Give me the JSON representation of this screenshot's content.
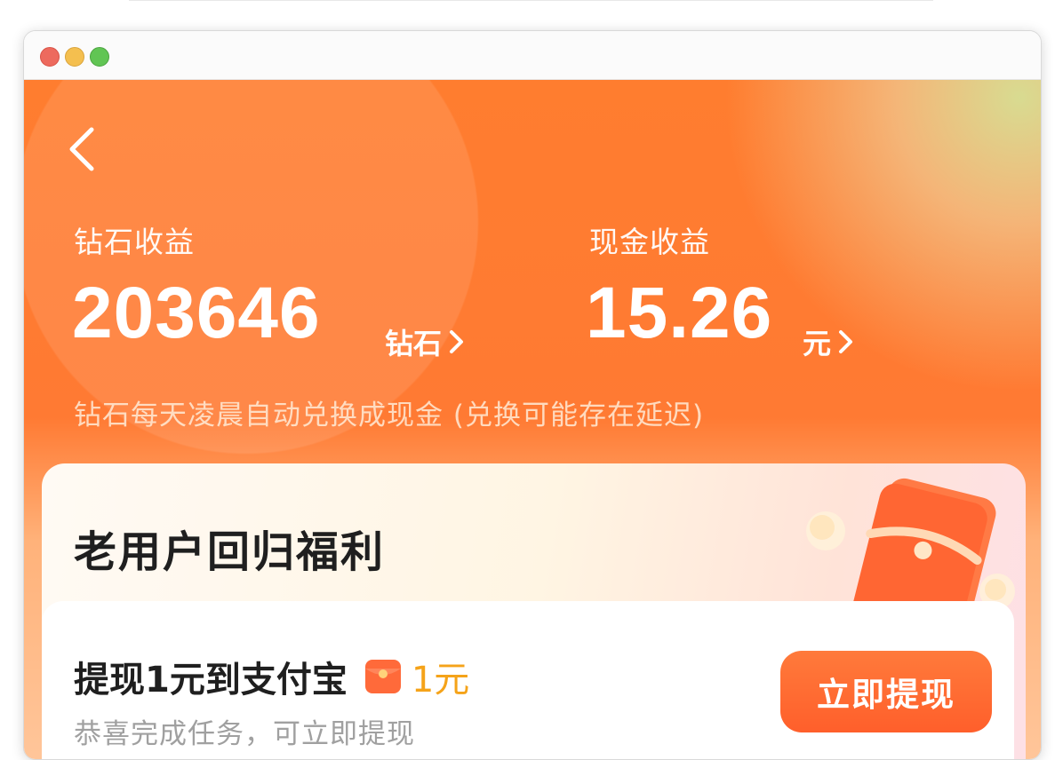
{
  "earnings": {
    "diamond": {
      "label": "钻石收益",
      "value": "203646",
      "unit": "钻石"
    },
    "cash": {
      "label": "现金收益",
      "value": "15.26",
      "unit": "元"
    },
    "note": "钻石每天凌晨自动兑换成现金 (兑换可能存在延迟)"
  },
  "welfare": {
    "title": "老用户回归福利",
    "task": {
      "title": "提现1元到支付宝",
      "reward": "1元",
      "subtitle": "恭喜完成任务，可立即提现",
      "button": "立即提现"
    }
  },
  "colors": {
    "primary": "#ff6a2e",
    "reward": "#f5a319",
    "hint_text": "#a0a0a0"
  },
  "icons": {
    "back": "chevron-left-icon",
    "more": "chevron-right-icon",
    "reward": "red-packet-icon"
  }
}
